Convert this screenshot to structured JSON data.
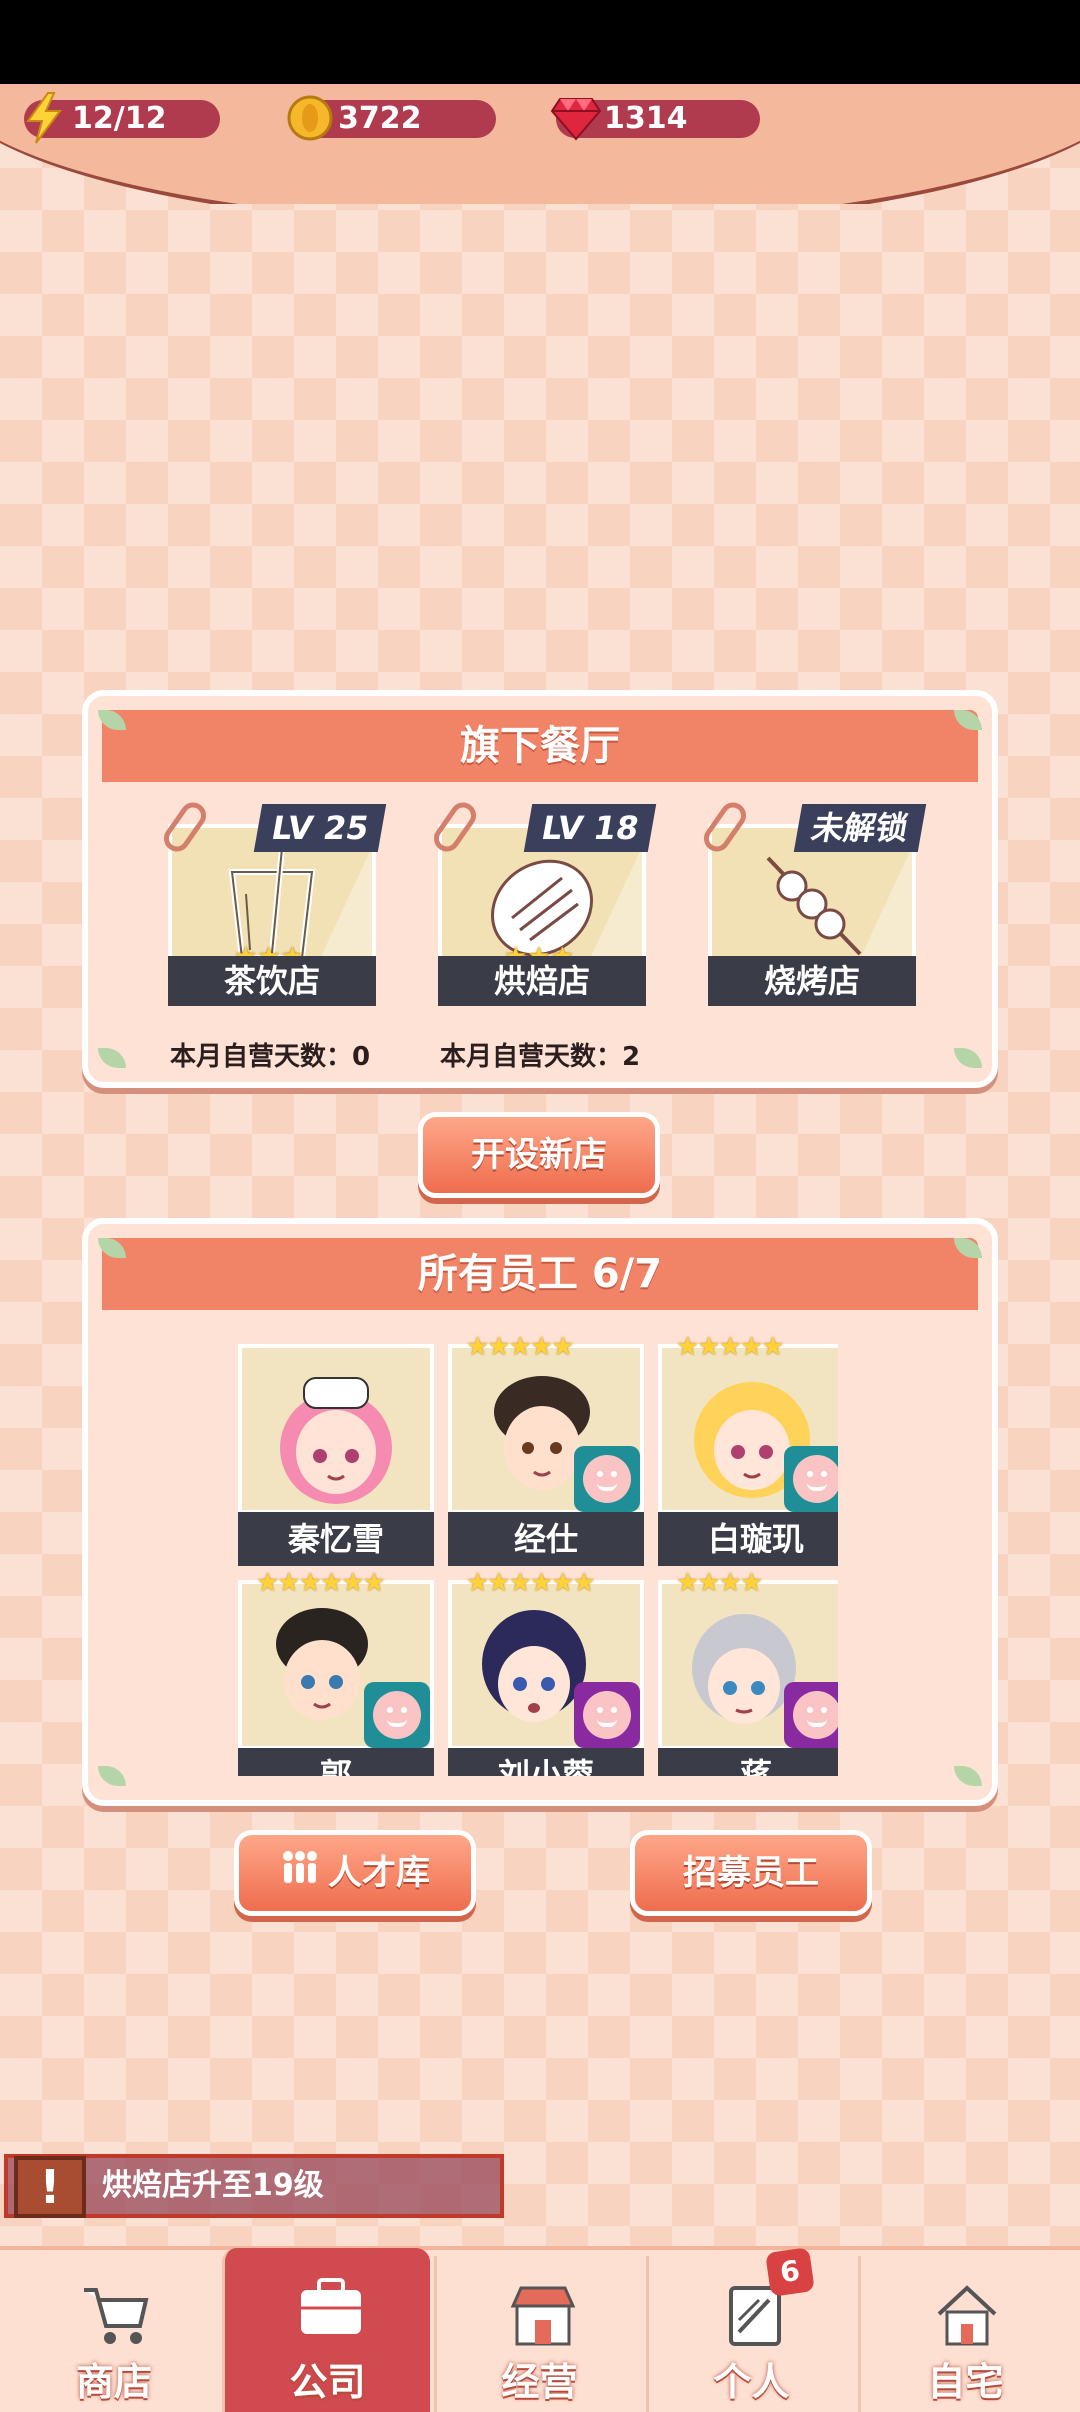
{
  "resources": {
    "energy": "12/12",
    "coins": "3722",
    "gems": "1314"
  },
  "restaurants": {
    "title": "旗下餐厅",
    "stores": [
      {
        "level": "LV 25",
        "name": "茶饮店",
        "stars": "★★★",
        "days_label": "本月自营天数：0"
      },
      {
        "level": "LV 18",
        "name": "烘焙店",
        "stars": "★★★",
        "days_label": "本月自营天数：2"
      },
      {
        "level": "未解锁",
        "name": "烧烤店"
      }
    ],
    "open_new_button": "开设新店"
  },
  "staff": {
    "title": "所有员工 6/7",
    "members": [
      {
        "name": "秦忆雪",
        "stars": ""
      },
      {
        "name": "经仕",
        "stars": "★★★★★"
      },
      {
        "name": "白璇玑",
        "stars": "★★★★★"
      },
      {
        "name": "郭",
        "stars": "★★★★★★"
      },
      {
        "name": "刘小蓉",
        "stars": "★★★★★★"
      },
      {
        "name": "蒋",
        "stars": "★★★★"
      }
    ],
    "talent_button": "人才库",
    "recruit_button": "招募员工"
  },
  "notification": {
    "text": "烘焙店升至19级",
    "icon": "!"
  },
  "nav": {
    "tabs": [
      {
        "label": "商店",
        "icon": "cart-icon"
      },
      {
        "label": "公司",
        "icon": "briefcase-icon",
        "active": true
      },
      {
        "label": "经营",
        "icon": "shop-icon"
      },
      {
        "label": "个人",
        "icon": "profile-icon",
        "badge": "6"
      },
      {
        "label": "自宅",
        "icon": "house-icon"
      }
    ]
  },
  "colors": {
    "accent": "#f18466",
    "resource_pill": "#b03a4e",
    "active_tab": "#d14a50",
    "label_bar": "#3a3c48"
  }
}
